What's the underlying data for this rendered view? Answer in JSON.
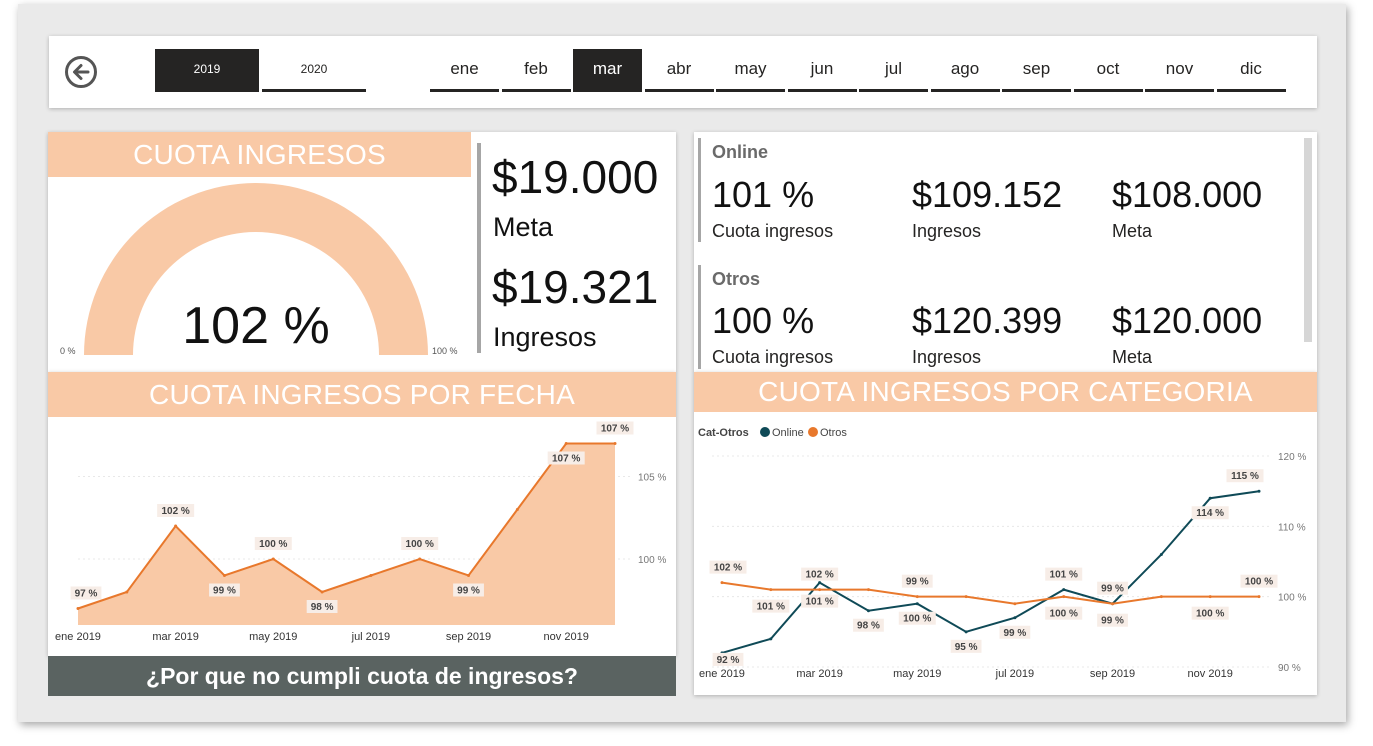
{
  "colors": {
    "accent": "#f9c9a6",
    "orange": "#e8782c",
    "online": "#0f4a57",
    "dark": "#252423",
    "question_bg": "#5a6361"
  },
  "icons": {
    "back": "back-arrow-circle-icon"
  },
  "years": [
    {
      "label": "2019",
      "selected": true
    },
    {
      "label": "2020",
      "selected": false
    }
  ],
  "months": [
    {
      "label": "ene",
      "selected": false
    },
    {
      "label": "feb",
      "selected": false
    },
    {
      "label": "mar",
      "selected": true
    },
    {
      "label": "abr",
      "selected": false
    },
    {
      "label": "may",
      "selected": false
    },
    {
      "label": "jun",
      "selected": false
    },
    {
      "label": "jul",
      "selected": false
    },
    {
      "label": "ago",
      "selected": false
    },
    {
      "label": "sep",
      "selected": false
    },
    {
      "label": "oct",
      "selected": false
    },
    {
      "label": "nov",
      "selected": false
    },
    {
      "label": "dic",
      "selected": false
    }
  ],
  "cuota": {
    "title": "CUOTA INGRESOS",
    "gauge_value": "102 %",
    "gauge_fraction": 1.0,
    "gauge_min": "0 %",
    "gauge_max": "100 %",
    "meta_value": "$19.000",
    "meta_label": "Meta",
    "ingresos_value": "$19.321",
    "ingresos_label": "Ingresos"
  },
  "categories": [
    {
      "name": "Online",
      "cuota": "101 %",
      "cuota_label": "Cuota ingresos",
      "ingresos": "$109.152",
      "ingresos_label": "Ingresos",
      "meta": "$108.000",
      "meta_label": "Meta"
    },
    {
      "name": "Otros",
      "cuota": "100 %",
      "cuota_label": "Cuota ingresos",
      "ingresos": "$120.399",
      "ingresos_label": "Ingresos",
      "meta": "$120.000",
      "meta_label": "Meta"
    }
  ],
  "fecha_title": "CUOTA INGRESOS POR FECHA",
  "categoria_title": "CUOTA INGRESOS POR CATEGORIA",
  "question": "¿Por que no cumpli cuota de ingresos?",
  "chart_data": [
    {
      "type": "area",
      "title": "CUOTA INGRESOS POR FECHA",
      "x": [
        "ene 2019",
        "feb 2019",
        "mar 2019",
        "abr 2019",
        "may 2019",
        "jun 2019",
        "jul 2019",
        "ago 2019",
        "sep 2019",
        "oct 2019",
        "nov 2019",
        "dic 2019"
      ],
      "x_tick_labels": [
        "ene 2019",
        "mar 2019",
        "may 2019",
        "jul 2019",
        "sep 2019",
        "nov 2019"
      ],
      "values": [
        97,
        98,
        102,
        99,
        100,
        98,
        99,
        100,
        99,
        103,
        107,
        107
      ],
      "data_labels": [
        "97 %",
        "",
        "102 %",
        "99 %",
        "100 %",
        "98 %",
        "",
        "100 %",
        "99 %",
        "",
        "107 %",
        "107 %"
      ],
      "y_ticks": [
        {
          "value": 100,
          "label": "100 %"
        },
        {
          "value": 105,
          "label": "105 %"
        }
      ],
      "ylim": [
        96,
        108
      ],
      "grid": true
    },
    {
      "type": "line",
      "title": "CUOTA INGRESOS POR CATEGORIA",
      "legend_title": "Cat-Otros",
      "legend": [
        "Online",
        "Otros"
      ],
      "legend_position": "top-left",
      "x": [
        "ene 2019",
        "feb 2019",
        "mar 2019",
        "abr 2019",
        "may 2019",
        "jun 2019",
        "jul 2019",
        "ago 2019",
        "sep 2019",
        "oct 2019",
        "nov 2019",
        "dic 2019"
      ],
      "x_tick_labels": [
        "ene 2019",
        "mar 2019",
        "may 2019",
        "jul 2019",
        "sep 2019",
        "nov 2019"
      ],
      "series": [
        {
          "name": "Online",
          "values": [
            92,
            94,
            102,
            98,
            99,
            95,
            97,
            101,
            99,
            106,
            114,
            115
          ],
          "data_labels": [
            "92 %",
            "",
            "101 %",
            "98 %",
            "100 %",
            "95 %",
            "99 %",
            "101 %",
            "99 %",
            "",
            "114 %",
            "115 %"
          ]
        },
        {
          "name": "Otros",
          "values": [
            102,
            101,
            101,
            101,
            100,
            100,
            99,
            100,
            99,
            100,
            100,
            100
          ],
          "data_labels": [
            "102 %",
            "101 %",
            "102 %",
            "",
            "99 %",
            "",
            "",
            "100 %",
            "99 %",
            "",
            "100 %",
            "100 %"
          ]
        }
      ],
      "y_ticks": [
        {
          "value": 90,
          "label": "90 %"
        },
        {
          "value": 100,
          "label": "100 %"
        },
        {
          "value": 110,
          "label": "110 %"
        },
        {
          "value": 120,
          "label": "120 %"
        }
      ],
      "ylim": [
        89,
        122
      ],
      "grid": true
    }
  ]
}
